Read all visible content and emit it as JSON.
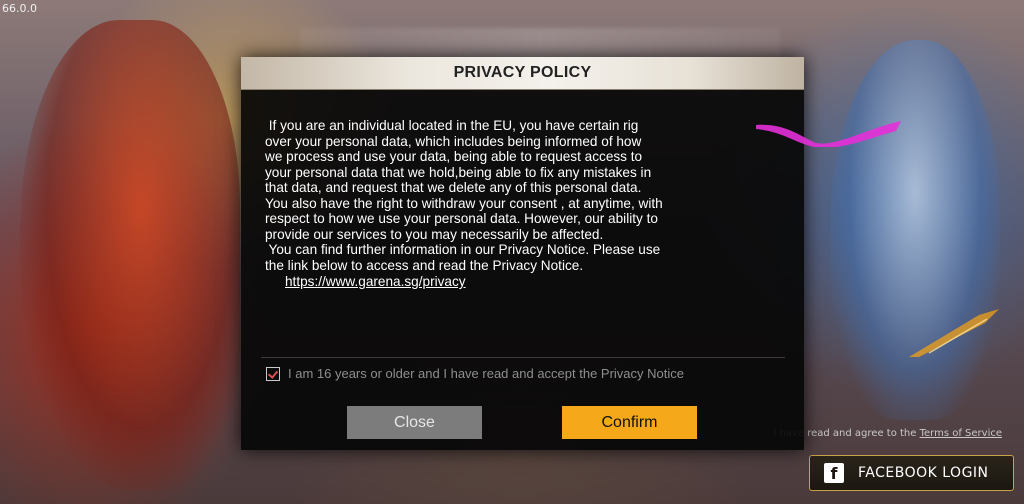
{
  "version": "66.0.0",
  "dialog": {
    "title": "PRIVACY POLICY",
    "policy_lines": [
      " If you are an individual located in the EU, you have certain rig",
      "over your personal data, which includes being informed of how",
      "we process and use your data, being able to request access to",
      "your personal data that we hold,being able to fix any mistakes in",
      "that data, and request that we delete any of this personal data.",
      "You also have the right to withdraw your consent , at anytime, with",
      "respect to how we use your personal data. However, our ability to",
      "provide our services to you may necessarily be affected.",
      " You can find further information in our Privacy Notice. Please use",
      "the link below to access and read the Privacy Notice."
    ],
    "privacy_link": "https://www.garena.sg/privacy",
    "consent": {
      "checked": true,
      "label": "I am 16 years or older and I have read and accept the Privacy Notice"
    },
    "close_label": "Close",
    "confirm_label": "Confirm"
  },
  "footer": {
    "terms_prefix": "I have read and agree to the",
    "terms_link": "Terms of Service"
  },
  "facebook_login": {
    "icon": "facebook-icon",
    "label": "FACEBOOK LOGIN"
  },
  "colors": {
    "confirm": "#f4a81a",
    "close": "#7c7c7c",
    "header": "#f4f1ec",
    "facebook_border": "#caa04a"
  }
}
